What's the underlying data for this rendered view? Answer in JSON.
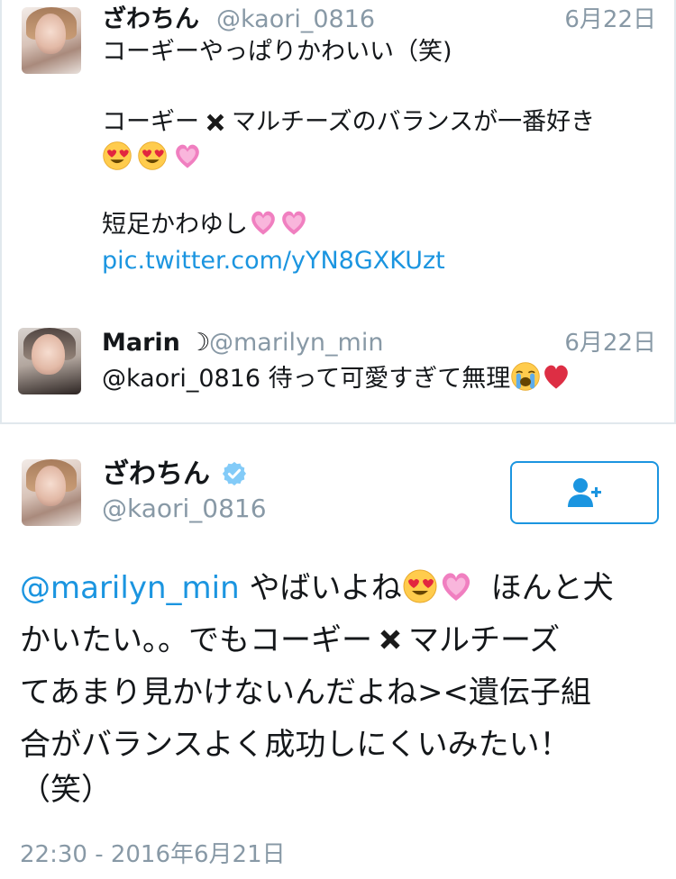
{
  "tweet1": {
    "name": "ざわちん",
    "handle": "@kaori_0816",
    "date": "6月22日",
    "line1": "コーギーやっぱりかわいい（笑)",
    "line2a": "コーギー",
    "line2b": "マルチーズのバランスが一番好き",
    "line4": "短足かわゆし",
    "link": "pic.twitter.com/yYN8GXKUzt"
  },
  "reply": {
    "name": "Marin",
    "moon": "☽",
    "handle": "@marilyn_min",
    "date": "6月22日",
    "text": "@kaori_0816 待って可愛すぎて無理"
  },
  "main_tweet": {
    "name": "ざわちん",
    "handle": "@kaori_0816",
    "mention": "@marilyn_min",
    "line1a": "やばいよね",
    "line1b": "ほんと犬",
    "line2a": "かいたい。。でもコーギー",
    "line2b": "マルチーズ",
    "line3": "てあまり見かけないんだよね><遺伝子組",
    "line4": "合がバランスよく成功しにくいみたい！",
    "line5": "（笑）",
    "timestamp": "22:30 - 2016年6月21日"
  },
  "icons": {
    "verified": "verified-badge-icon",
    "follow": "follow-user-icon",
    "cross": "heavy-x-icon",
    "heart_eyes": "heart-eyes-emoji",
    "pink_heart": "growing-heart-emoji",
    "crying": "loudly-crying-emoji",
    "red_heart": "red-heart-emoji"
  },
  "colors": {
    "link": "#1b95e0",
    "muted": "#8899a6",
    "text": "#14171a",
    "divider": "#e1e8ed"
  }
}
